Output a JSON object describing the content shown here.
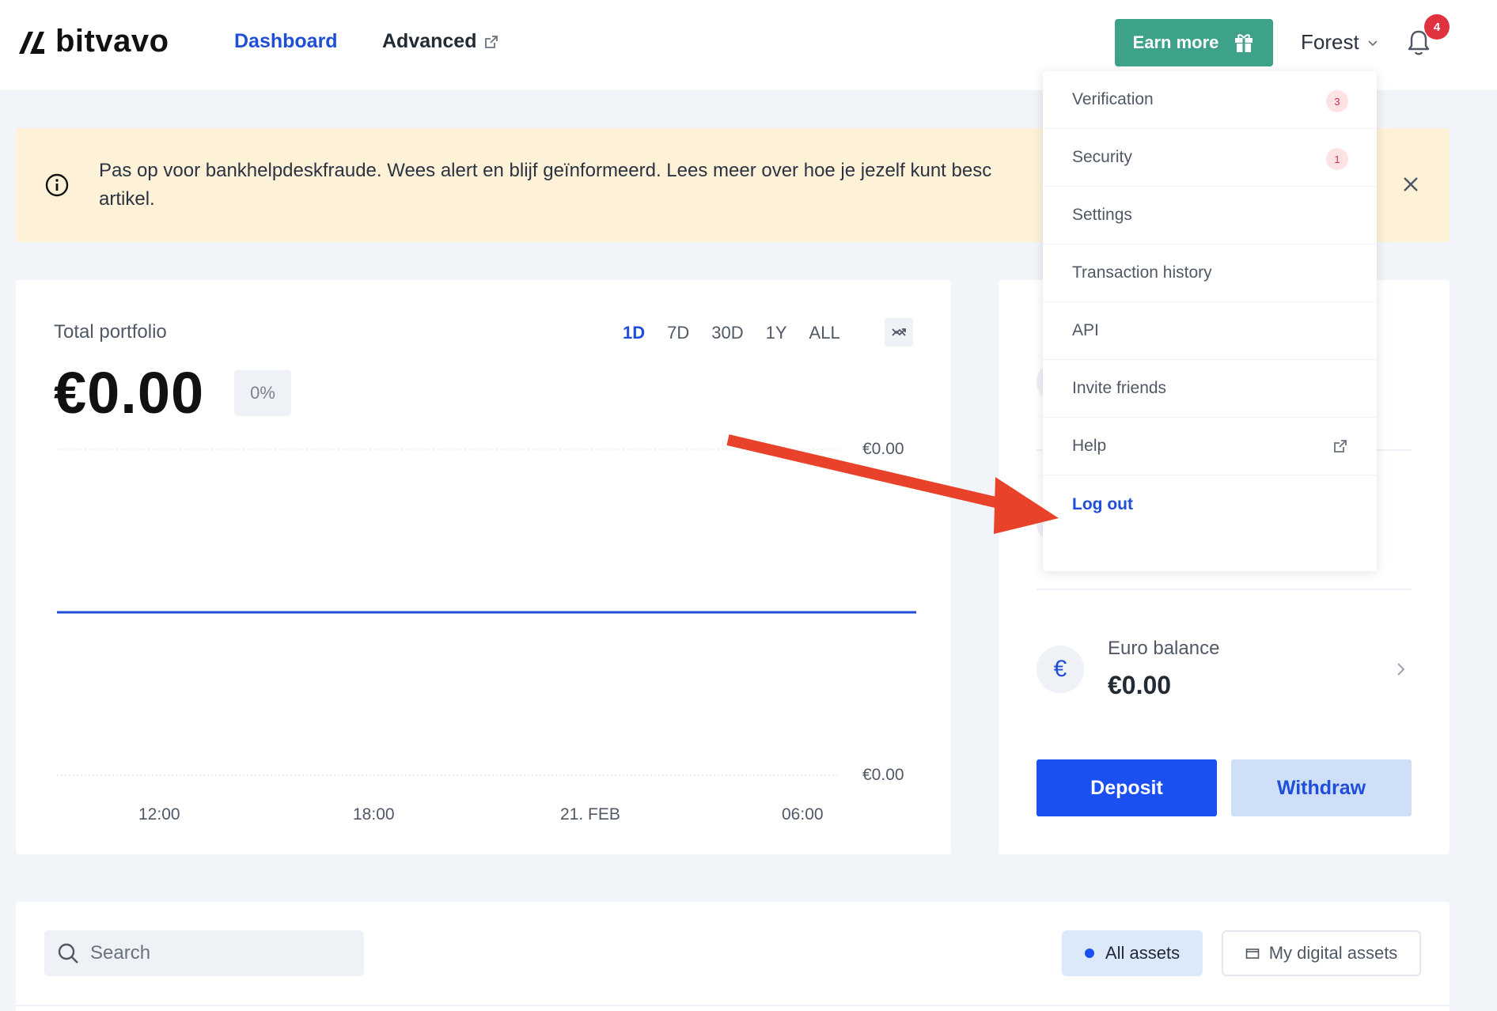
{
  "header": {
    "logo_text": "bitvavo",
    "nav": {
      "dashboard": "Dashboard",
      "advanced": "Advanced"
    },
    "earn_label": "Earn more",
    "user_name": "Forest",
    "notification_count": "4"
  },
  "banner": {
    "text_line1": "Pas op voor bankhelpdeskfraude. Wees alert en blijf geïnformeerd. Lees meer over hoe je jezelf kunt besc",
    "text_line2": "artikel."
  },
  "portfolio": {
    "title": "Total portfolio",
    "value": "€0.00",
    "change": "0%",
    "ranges": [
      "1D",
      "7D",
      "30D",
      "1Y",
      "ALL"
    ],
    "active_range": "1D"
  },
  "chart_data": {
    "type": "line",
    "x": [
      "12:00",
      "18:00",
      "21. FEB",
      "06:00"
    ],
    "y_ticks": [
      "€0.00",
      "€0.00"
    ],
    "series": [
      {
        "values": [
          0,
          0,
          0,
          0
        ]
      }
    ],
    "color": "#1f4ed8",
    "grid": true
  },
  "balance": {
    "euro_symbol": "€",
    "euro_label": "Euro balance",
    "euro_value": "€0.00",
    "deposit_label": "Deposit",
    "withdraw_label": "Withdraw"
  },
  "assets": {
    "search_placeholder": "Search",
    "filter_all": "All assets",
    "filter_mine": "My digital assets"
  },
  "user_dropdown": {
    "items": [
      {
        "label": "Verification",
        "badge": "3"
      },
      {
        "label": "Security",
        "badge": "1"
      },
      {
        "label": "Settings"
      },
      {
        "label": "Transaction history"
      },
      {
        "label": "API"
      },
      {
        "label": "Invite friends"
      },
      {
        "label": "Help"
      },
      {
        "label": "Log out"
      }
    ]
  },
  "colors": {
    "brand_blue": "#1f4ed8",
    "earn_green": "#3ea28a",
    "banner_bg": "#fdf1d8",
    "annotation_arrow": "#e8432a",
    "badge_red": "#e1323f"
  }
}
